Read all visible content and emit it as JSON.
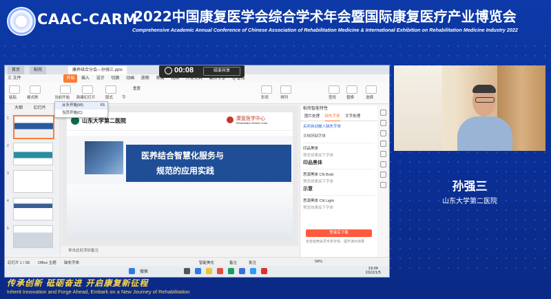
{
  "header": {
    "logo_text": "CAAC-CARM",
    "title": "2022中国康复医学会综合学术年会暨国际康复医疗产业博览会",
    "subtitle": "Comprehensive Academic Annual Conference of Chinese Association of Rehabilitation Medicine & International Exhibition on Rehabilitation Medicine Industry 2022"
  },
  "app": {
    "tabs": [
      "首页",
      "稻壳",
      "康养结合分会---孙强三.pptx"
    ],
    "toolbar": [
      "三 文件",
      "开始",
      "插入",
      "设计",
      "切换",
      "动画",
      "放映",
      "审阅",
      "视图",
      "开发工具",
      "会员专享",
      "Q 查找"
    ],
    "ribbon_labels": [
      "粘贴",
      "格式刷",
      "当前开始",
      "新建幻灯片",
      "版式",
      "节",
      "重置",
      "形状",
      "排列",
      "查找",
      "替换",
      "选择"
    ],
    "menu": [
      "从头开始(W)",
      "当页开始(C)"
    ],
    "menu_shortcut": "F5",
    "timer": {
      "time": "00:08",
      "end_label": "结束共享"
    },
    "view_tabs": [
      "大纲",
      "幻灯片"
    ],
    "thumb_numbers": [
      "1",
      "2",
      "3",
      "4",
      "5"
    ],
    "notes": "单击此处添加备注",
    "status": {
      "slide": "幻灯片 1 / 38",
      "theme": "Office 主题",
      "font": "缺失字体",
      "zoom": "58%",
      "beautify": "智能美化",
      "remarks": "备注",
      "comment": "批注"
    }
  },
  "slide": {
    "hospital": "山东大学第二医院",
    "center": "康复医学中心",
    "center_en": "Rehabilitation Medical Center",
    "title_line1": "医养结合智慧化服务与",
    "title_line2": "规范的应用实践"
  },
  "panel": {
    "header": "稻壳智能特性",
    "tabs": [
      "图片处理",
      "缺失字体",
      "文字处理"
    ],
    "link": "关闭自动嵌入缺失字体",
    "section": "文档所缺字体",
    "fonts": [
      {
        "name": "印品黑体",
        "hint": "预览效果如下字体",
        "sample": "印品黑体"
      },
      {
        "name": "思源黑体 CN Bold",
        "hint": "预览效果如下字体",
        "sample": "示意"
      },
      {
        "name": "思源黑体 CN Light",
        "hint": "预览效果如下字体",
        "sample": ""
      }
    ],
    "button": "登录后下载",
    "tip": "包含稻壳会员专享字体，提升演示效果"
  },
  "taskbar": {
    "search": "搜索",
    "time": "19:04",
    "date": "2022/1/5"
  },
  "speaker": {
    "name": "孙强三",
    "org": "山东大学第二医院"
  },
  "slogan": {
    "cn": "传承创新 砥砺奋进 开启康复新征程",
    "en": "Inherit Innovation and Forge Ahead, Embark on a New Journey of Rehabilitation"
  }
}
